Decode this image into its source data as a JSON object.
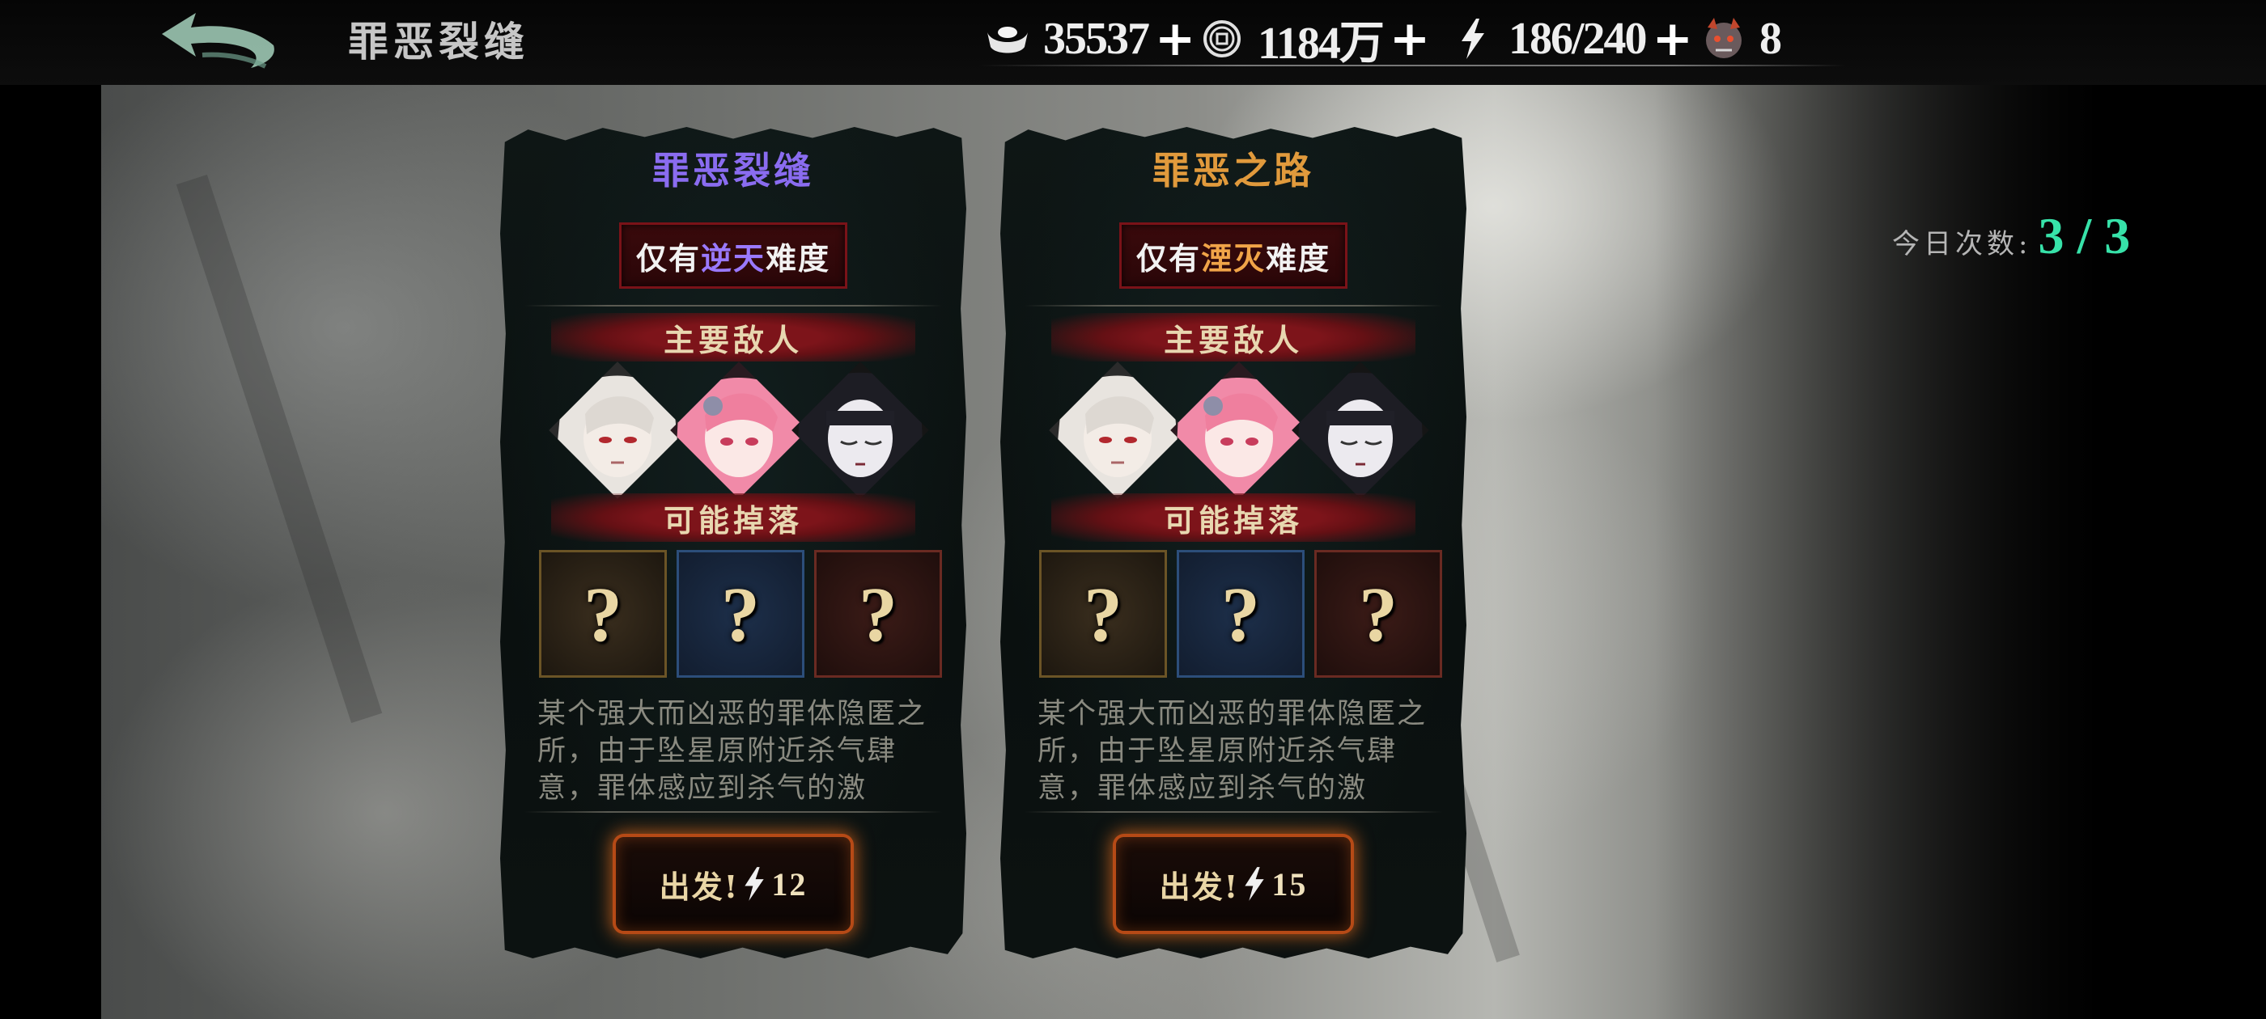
{
  "header": {
    "title": "罪恶裂缝",
    "resources": [
      {
        "name": "silver-ingot",
        "value": "35537"
      },
      {
        "name": "coin",
        "value": "1184万"
      },
      {
        "name": "stamina",
        "value": "186/240"
      },
      {
        "name": "special-token",
        "value": "8"
      }
    ]
  },
  "daily": {
    "label": "今日次数:",
    "value": "3 / 3"
  },
  "cards": [
    {
      "title": "罪恶裂缝",
      "title_color": "#8a6cf0",
      "difficulty_prefix": "仅有",
      "difficulty_name": "逆天",
      "difficulty_color": "#9a79ff",
      "difficulty_suffix": "难度",
      "enemies_label": "主要敌人",
      "drops_label": "可能掉落",
      "drops": [
        "?",
        "?",
        "?"
      ],
      "description": "某个强大而凶恶的罪体隐匿之所，由于坠星原附近杀气肆意，罪体感应到杀气的激",
      "go_label": "出发!",
      "cost": "12"
    },
    {
      "title": "罪恶之路",
      "title_color": "#e19a3c",
      "difficulty_prefix": "仅有",
      "difficulty_name": "湮灭",
      "difficulty_color": "#f0a448",
      "difficulty_suffix": "难度",
      "enemies_label": "主要敌人",
      "drops_label": "可能掉落",
      "drops": [
        "?",
        "?",
        "?"
      ],
      "description": "某个强大而凶恶的罪体隐匿之所，由于坠星原附近杀气肆意，罪体感应到杀气的激",
      "go_label": "出发!",
      "cost": "15"
    }
  ]
}
